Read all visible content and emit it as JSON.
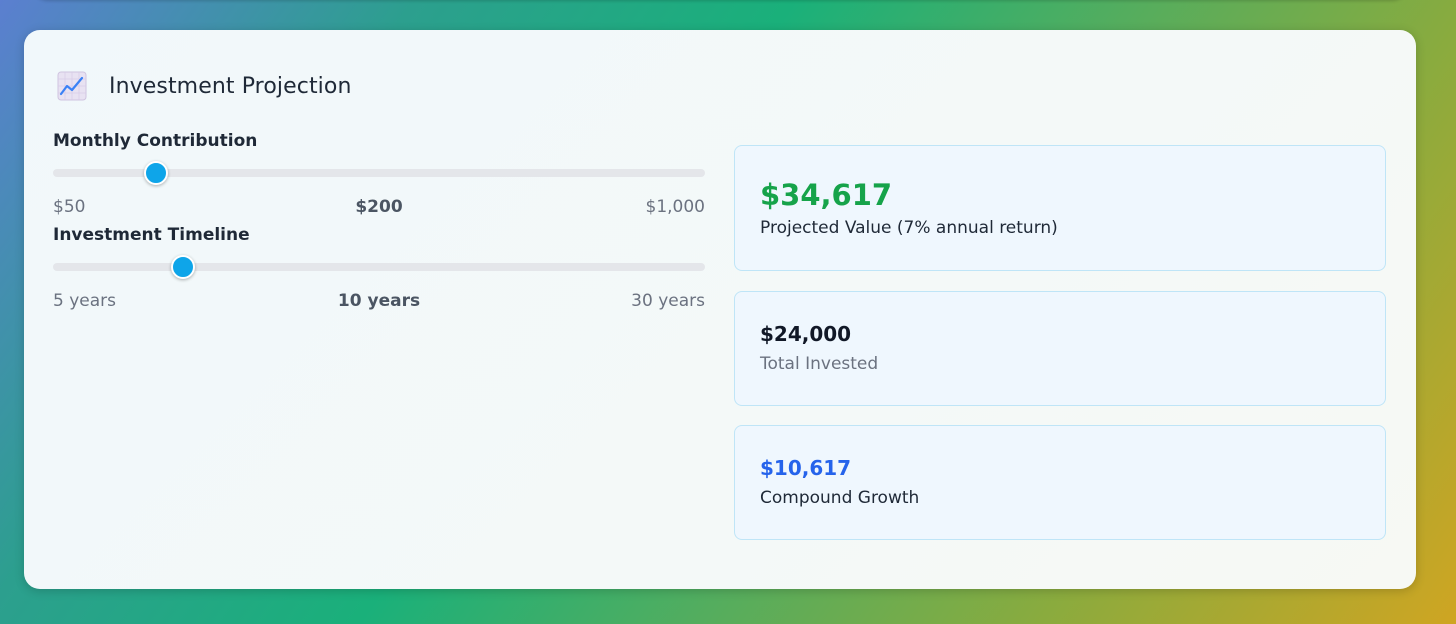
{
  "header": {
    "icon": "chart-increasing-icon",
    "title": "Investment Projection"
  },
  "sliders": {
    "monthly": {
      "label": "Monthly Contribution",
      "min_label": "$50",
      "max_label": "$1,000",
      "value_label": "$200",
      "min": 50,
      "max": 1000,
      "value": 200
    },
    "timeline": {
      "label": "Investment Timeline",
      "min_label": "5 years",
      "max_label": "30 years",
      "value_label": "10 years",
      "min": 5,
      "max": 30,
      "value": 10
    }
  },
  "stats": {
    "projected": {
      "value": "$34,617",
      "label": "Projected Value (7% annual return)"
    },
    "invested": {
      "value": "$24,000",
      "label": "Total Invested"
    },
    "growth": {
      "value": "$10,617",
      "label": "Compound Growth"
    }
  },
  "colors": {
    "accent": "#0ea5e9",
    "positive": "#16a34a",
    "growth": "#2563eb",
    "stat_border": "#bfe5f7",
    "stat_bg": "#eff7fe"
  }
}
